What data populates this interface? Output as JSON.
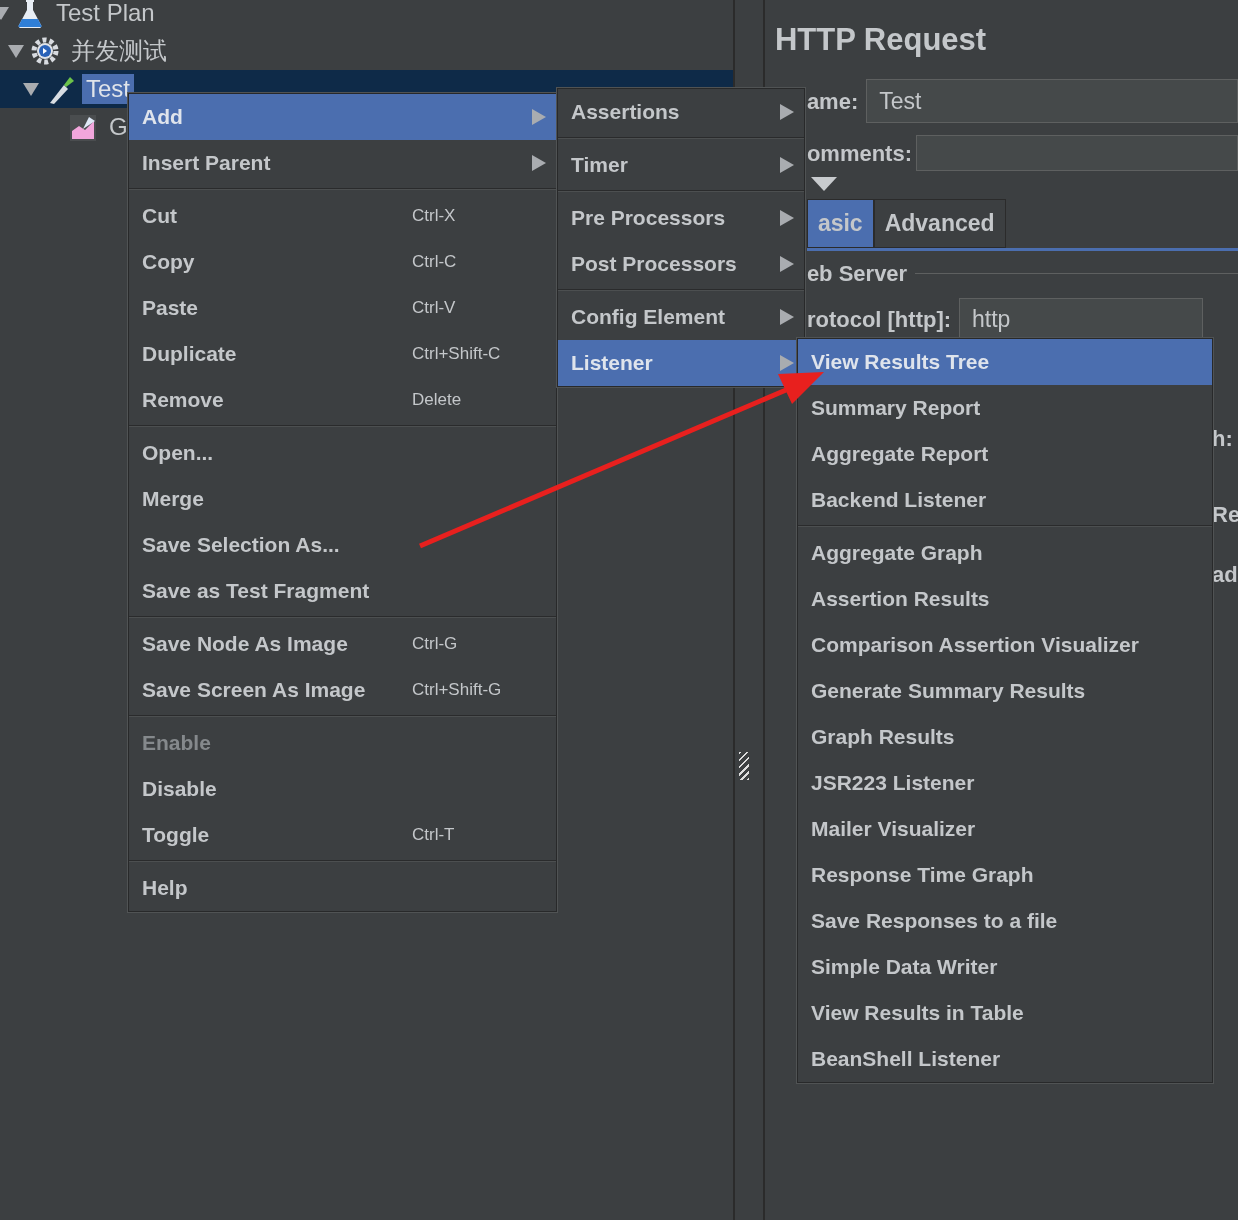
{
  "tree": [
    {
      "label": "Test Plan",
      "kind": "plan",
      "expanded": true,
      "selected": false,
      "children": [
        {
          "label": "并发测试",
          "kind": "thread-group",
          "expanded": true,
          "selected": false,
          "children": [
            {
              "label": "Test",
              "kind": "sampler",
              "expanded": true,
              "selected": true,
              "children": [
                {
                  "label": "G",
                  "kind": "listener",
                  "selected": false
                }
              ]
            }
          ]
        }
      ]
    }
  ],
  "editor": {
    "title": "HTTP Request",
    "name_label": "ame:",
    "name_value": "Test",
    "comments_label": "omments:",
    "tabs": [
      {
        "label": "asic",
        "selected": true
      },
      {
        "label": "Advanced",
        "selected": false
      }
    ],
    "section": "eb Server",
    "protocol_label": "rotocol [http]:",
    "protocol_value": "http",
    "edge_texts": [
      "h:",
      "Re",
      "ad"
    ]
  },
  "context_menu": {
    "groups": [
      [
        {
          "label": "Add",
          "has_submenu": true,
          "selected": true,
          "disabled": false
        },
        {
          "label": "Insert Parent",
          "has_submenu": true,
          "selected": false,
          "disabled": false
        }
      ],
      [
        {
          "label": "Cut",
          "shortcut": "Ctrl-X",
          "has_submenu": false,
          "selected": false,
          "disabled": false
        },
        {
          "label": "Copy",
          "shortcut": "Ctrl-C",
          "has_submenu": false,
          "selected": false,
          "disabled": false
        },
        {
          "label": "Paste",
          "shortcut": "Ctrl-V",
          "has_submenu": false,
          "selected": false,
          "disabled": false
        },
        {
          "label": "Duplicate",
          "shortcut": "Ctrl+Shift-C",
          "has_submenu": false,
          "selected": false,
          "disabled": false
        },
        {
          "label": "Remove",
          "shortcut": "Delete",
          "has_submenu": false,
          "selected": false,
          "disabled": false
        }
      ],
      [
        {
          "label": "Open...",
          "has_submenu": false,
          "selected": false,
          "disabled": false
        },
        {
          "label": "Merge",
          "has_submenu": false,
          "selected": false,
          "disabled": false
        },
        {
          "label": "Save Selection As...",
          "has_submenu": false,
          "selected": false,
          "disabled": false
        },
        {
          "label": "Save as Test Fragment",
          "has_submenu": false,
          "selected": false,
          "disabled": false
        }
      ],
      [
        {
          "label": "Save Node As Image",
          "shortcut": "Ctrl-G",
          "has_submenu": false,
          "selected": false,
          "disabled": false
        },
        {
          "label": "Save Screen As Image",
          "shortcut": "Ctrl+Shift-G",
          "has_submenu": false,
          "selected": false,
          "disabled": false
        }
      ],
      [
        {
          "label": "Enable",
          "has_submenu": false,
          "selected": false,
          "disabled": true
        },
        {
          "label": "Disable",
          "has_submenu": false,
          "selected": false,
          "disabled": false
        },
        {
          "label": "Toggle",
          "shortcut": "Ctrl-T",
          "has_submenu": false,
          "selected": false,
          "disabled": false
        }
      ],
      [
        {
          "label": "Help",
          "has_submenu": false,
          "selected": false,
          "disabled": false
        }
      ]
    ]
  },
  "add_submenu": {
    "groups": [
      [
        {
          "label": "Assertions",
          "has_submenu": true,
          "selected": false,
          "disabled": false
        }
      ],
      [
        {
          "label": "Timer",
          "has_submenu": true,
          "selected": false,
          "disabled": false
        }
      ],
      [
        {
          "label": "Pre Processors",
          "has_submenu": true,
          "selected": false,
          "disabled": false
        },
        {
          "label": "Post Processors",
          "has_submenu": true,
          "selected": false,
          "disabled": false
        }
      ],
      [
        {
          "label": "Config Element",
          "has_submenu": true,
          "selected": false,
          "disabled": false
        },
        {
          "label": "Listener",
          "has_submenu": true,
          "selected": true,
          "disabled": false
        }
      ]
    ]
  },
  "listener_submenu": {
    "groups": [
      [
        {
          "label": "View Results Tree",
          "has_submenu": false,
          "selected": true,
          "disabled": false
        },
        {
          "label": "Summary Report",
          "has_submenu": false,
          "selected": false,
          "disabled": false
        },
        {
          "label": "Aggregate Report",
          "has_submenu": false,
          "selected": false,
          "disabled": false
        },
        {
          "label": "Backend Listener",
          "has_submenu": false,
          "selected": false,
          "disabled": false
        }
      ],
      [
        {
          "label": "Aggregate Graph",
          "has_submenu": false,
          "selected": false,
          "disabled": false
        },
        {
          "label": "Assertion Results",
          "has_submenu": false,
          "selected": false,
          "disabled": false
        },
        {
          "label": "Comparison Assertion Visualizer",
          "has_submenu": false,
          "selected": false,
          "disabled": false
        },
        {
          "label": "Generate Summary Results",
          "has_submenu": false,
          "selected": false,
          "disabled": false
        },
        {
          "label": "Graph Results",
          "has_submenu": false,
          "selected": false,
          "disabled": false
        },
        {
          "label": "JSR223 Listener",
          "has_submenu": false,
          "selected": false,
          "disabled": false
        },
        {
          "label": "Mailer Visualizer",
          "has_submenu": false,
          "selected": false,
          "disabled": false
        },
        {
          "label": "Response Time Graph",
          "has_submenu": false,
          "selected": false,
          "disabled": false
        },
        {
          "label": "Save Responses to a file",
          "has_submenu": false,
          "selected": false,
          "disabled": false
        },
        {
          "label": "Simple Data Writer",
          "has_submenu": false,
          "selected": false,
          "disabled": false
        },
        {
          "label": "View Results in Table",
          "has_submenu": false,
          "selected": false,
          "disabled": false
        },
        {
          "label": "BeanShell Listener",
          "has_submenu": false,
          "selected": false,
          "disabled": false
        }
      ]
    ]
  }
}
